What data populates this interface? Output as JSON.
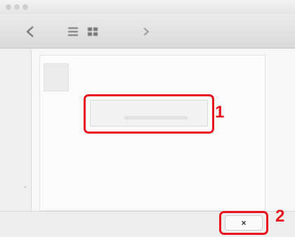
{
  "window": {
    "title": ""
  },
  "toolbar": {
    "buttons": [
      "back-icon",
      "list-icon",
      "grid-icon",
      "forward-icon"
    ]
  },
  "dialog": {
    "heading": "",
    "body_lines": [
      "",
      ""
    ],
    "field_text": ""
  },
  "bottom_bar": {
    "label": "",
    "close_label": "×"
  },
  "callouts": {
    "one": "1",
    "two": "2"
  },
  "colors": {
    "highlight": "#e8141e"
  }
}
